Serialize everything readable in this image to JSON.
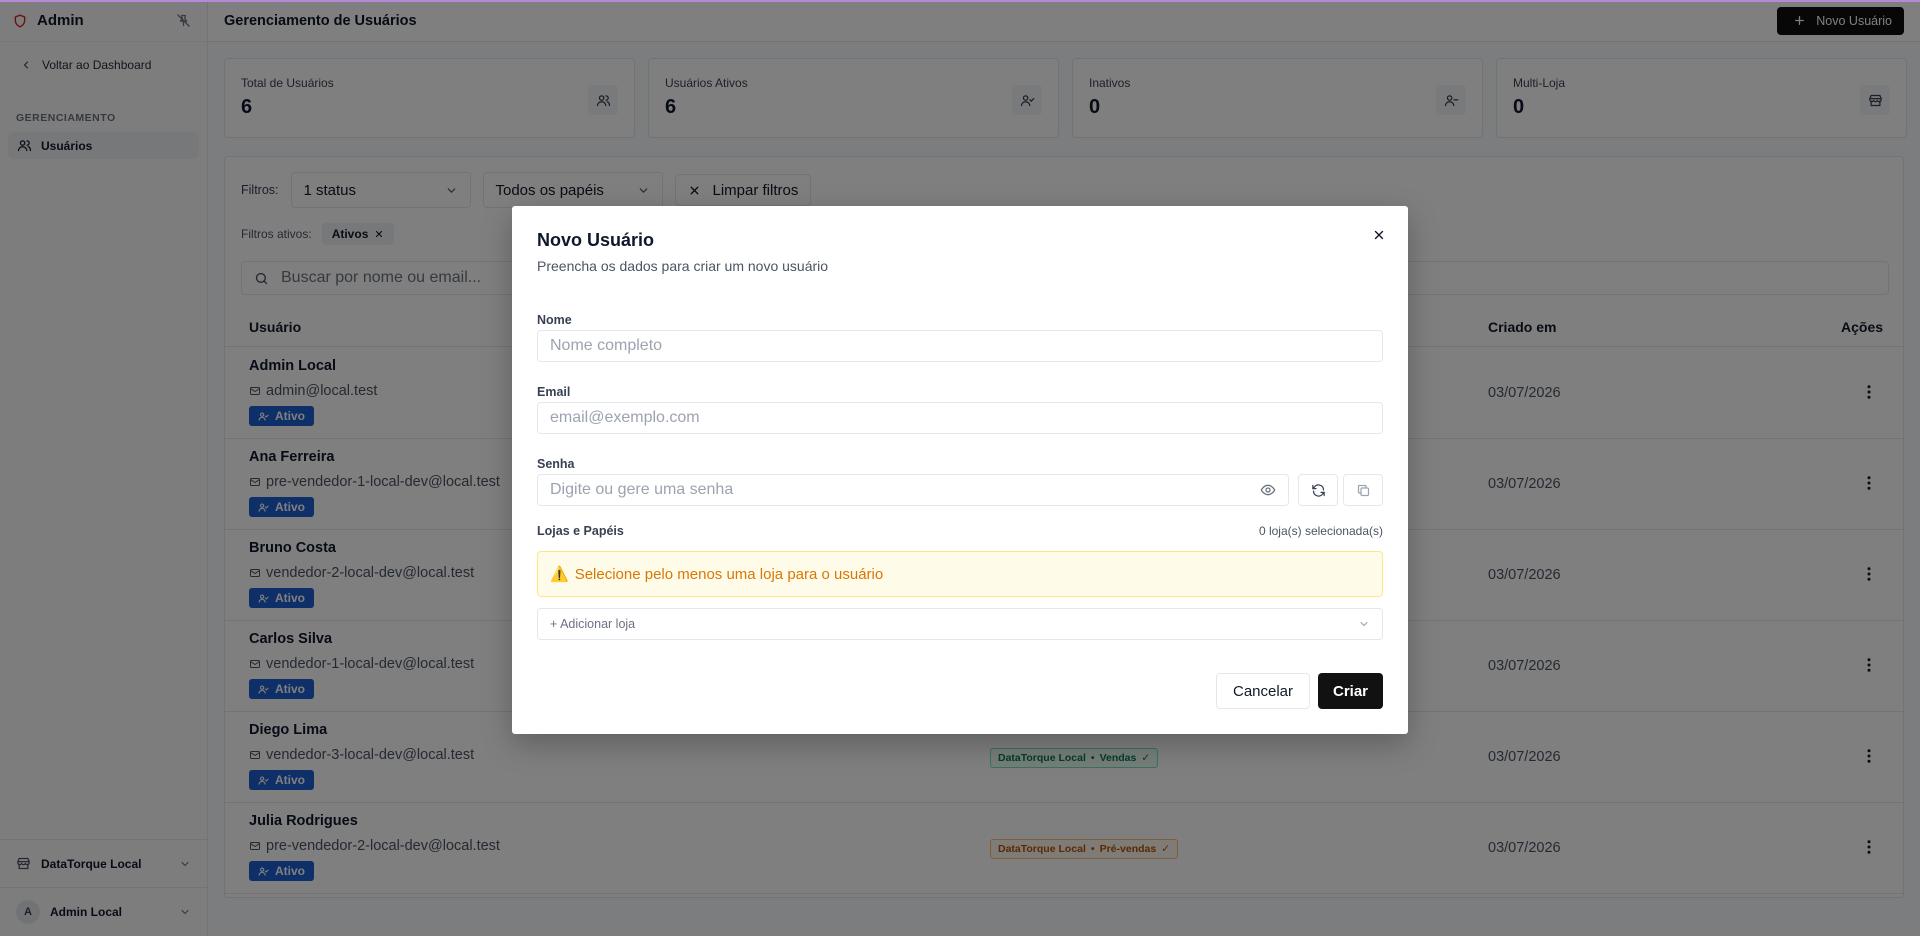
{
  "sidebar": {
    "brand": "Admin",
    "back_label": "Voltar ao Dashboard",
    "section_label": "GERENCIAMENTO",
    "items": [
      {
        "label": "Usuários"
      }
    ],
    "store": "DataTorque Local",
    "user_initial": "A",
    "user_name": "Admin Local"
  },
  "header": {
    "title": "Gerenciamento de Usuários",
    "new_user_label": "Novo Usuário"
  },
  "stats": [
    {
      "label": "Total de Usuários",
      "value": "6"
    },
    {
      "label": "Usuários Ativos",
      "value": "6"
    },
    {
      "label": "Inativos",
      "value": "0"
    },
    {
      "label": "Multi-Loja",
      "value": "0"
    }
  ],
  "filters": {
    "label": "Filtros:",
    "status_value": "1 status",
    "roles_value": "Todos os papéis",
    "clear_label": "Limpar filtros",
    "active_label": "Filtros ativos:",
    "active_chip": "Ativos",
    "search_placeholder": "Buscar por nome ou email..."
  },
  "table": {
    "columns": [
      "Usuário",
      "Criado em",
      "Ações"
    ],
    "rows": [
      {
        "name": "Admin Local",
        "email": "admin@local.test",
        "status": "Ativo",
        "created": "03/07/2026",
        "role": null
      },
      {
        "name": "Ana Ferreira",
        "email": "pre-vendedor-1-local-dev@local.test",
        "status": "Ativo",
        "created": "03/07/2026",
        "role": null
      },
      {
        "name": "Bruno Costa",
        "email": "vendedor-2-local-dev@local.test",
        "status": "Ativo",
        "created": "03/07/2026",
        "role": null
      },
      {
        "name": "Carlos Silva",
        "email": "vendedor-1-local-dev@local.test",
        "status": "Ativo",
        "created": "03/07/2026",
        "role": null
      },
      {
        "name": "Diego Lima",
        "email": "vendedor-3-local-dev@local.test",
        "status": "Ativo",
        "created": "03/07/2026",
        "role": {
          "store": "DataTorque Local",
          "name": "Vendas",
          "check": "✓",
          "color": "#047857"
        }
      },
      {
        "name": "Julia Rodrigues",
        "email": "pre-vendedor-2-local-dev@local.test",
        "status": "Ativo",
        "created": "03/07/2026",
        "role": {
          "store": "DataTorque Local",
          "name": "Pré-vendas",
          "check": "✓",
          "color": "#b45309"
        }
      }
    ]
  },
  "modal": {
    "title": "Novo Usuário",
    "subtitle": "Preencha os dados para criar um novo usuário",
    "name_label": "Nome",
    "name_placeholder": "Nome completo",
    "email_label": "Email",
    "email_placeholder": "email@exemplo.com",
    "password_label": "Senha",
    "password_placeholder": "Digite ou gere uma senha",
    "stores_label": "Lojas e Papéis",
    "stores_count": "0 loja(s) selecionada(s)",
    "warning_icon": "⚠️",
    "warning": "Selecione pelo menos uma loja para o usuário",
    "add_store": "+ Adicionar loja",
    "cancel_label": "Cancelar",
    "create_label": "Criar"
  },
  "colors": {
    "accent_dark": "#111111",
    "status_blue": "#1d5fd0",
    "warning_text": "#d97706",
    "brand_red": "#dc2626"
  }
}
